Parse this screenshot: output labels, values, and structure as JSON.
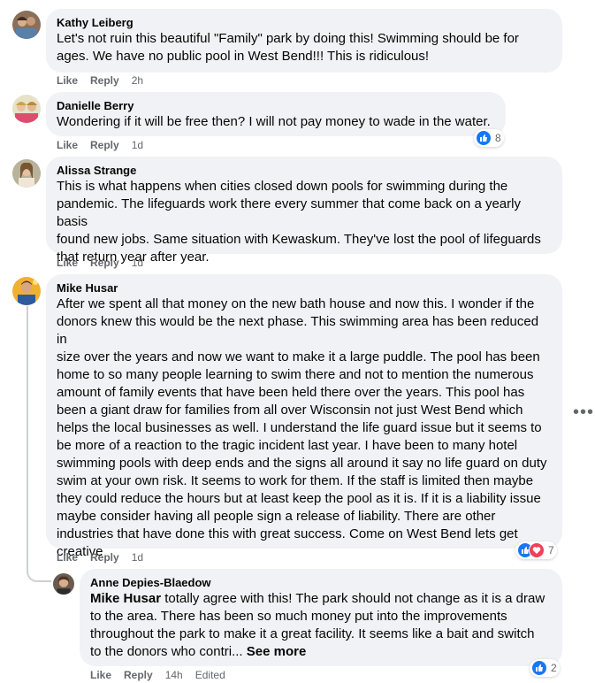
{
  "colors": {
    "bubble_bg": "#f0f2f5",
    "like_blue": "#1877f2",
    "love_red": "#f33e58",
    "meta_gray": "#65676b"
  },
  "comments": [
    {
      "author": "Kathy Leiberg",
      "lines": [
        "Let's not ruin this beautiful \"Family\" park by doing this! Swimming should be for",
        "ages. We have no public pool in West Bend!!! This is ridiculous!"
      ],
      "like": "Like",
      "reply": "Reply",
      "time": "2h"
    },
    {
      "author": "Danielle Berry",
      "lines": [
        "Wondering if it will be free then? I will not pay money to wade in the water."
      ],
      "like": "Like",
      "reply": "Reply",
      "time": "1d",
      "reactions": {
        "icons": [
          "like-icon"
        ],
        "count": "8"
      }
    },
    {
      "author": "Alissa Strange",
      "lines": [
        "This is what happens when cities closed down pools for swimming during the",
        "pandemic. The lifeguards work there every summer that come back on a yearly basis",
        "found new jobs. Same situation with Kewaskum. They've lost the pool of lifeguards",
        "that return year after year."
      ],
      "like": "Like",
      "reply": "Reply",
      "time": "1d"
    },
    {
      "author": "Mike Husar",
      "lines": [
        "After we spent all that money on the new bath house and now this. I wonder if the",
        "donors knew this would be the next phase. This swimming area has been reduced in",
        "size over the years and now we want to make it a large puddle. The pool has been",
        "home to so many people learning to swim there and not to mention the numerous",
        "amount of family events that have been held there over the years. This pool has",
        "been a giant draw for families from all over Wisconsin not just West Bend which",
        "helps the local businesses as well. I understand the life guard issue but it seems to",
        "be more of a reaction to the tragic incident last year. I have been to many hotel",
        "swimming pools with deep ends and the signs all around it say no life guard on duty",
        "swim at your own risk. It seems to work for them. If the staff is limited then maybe",
        "they could reduce the hours but at least keep the pool as it is. If it is a liability issue",
        "maybe consider having all people sign a release of liability. There are other",
        "industries that have done this with great success. Come on West Bend lets get",
        "creative"
      ],
      "like": "Like",
      "reply": "Reply",
      "time": "1d",
      "reactions": {
        "icons": [
          "like-icon",
          "love-icon"
        ],
        "count": "7"
      },
      "more_icon": "•••"
    }
  ],
  "reply": {
    "author": "Anne Depies-Blaedow",
    "mention": "Mike Husar",
    "first_line_rest": " totally agree with this! The park should not change as it is a draw",
    "lines": [
      "to the area. There has been so much money put into the improvements",
      "throughout the park to make it a great facility. It seems like a bait and switch"
    ],
    "last_line": "to the donors who contri... ",
    "see_more": "See more",
    "like": "Like",
    "reply": "Reply",
    "time": "14h",
    "edited": "Edited",
    "reactions": {
      "icons": [
        "like-icon"
      ],
      "count": "2"
    }
  }
}
